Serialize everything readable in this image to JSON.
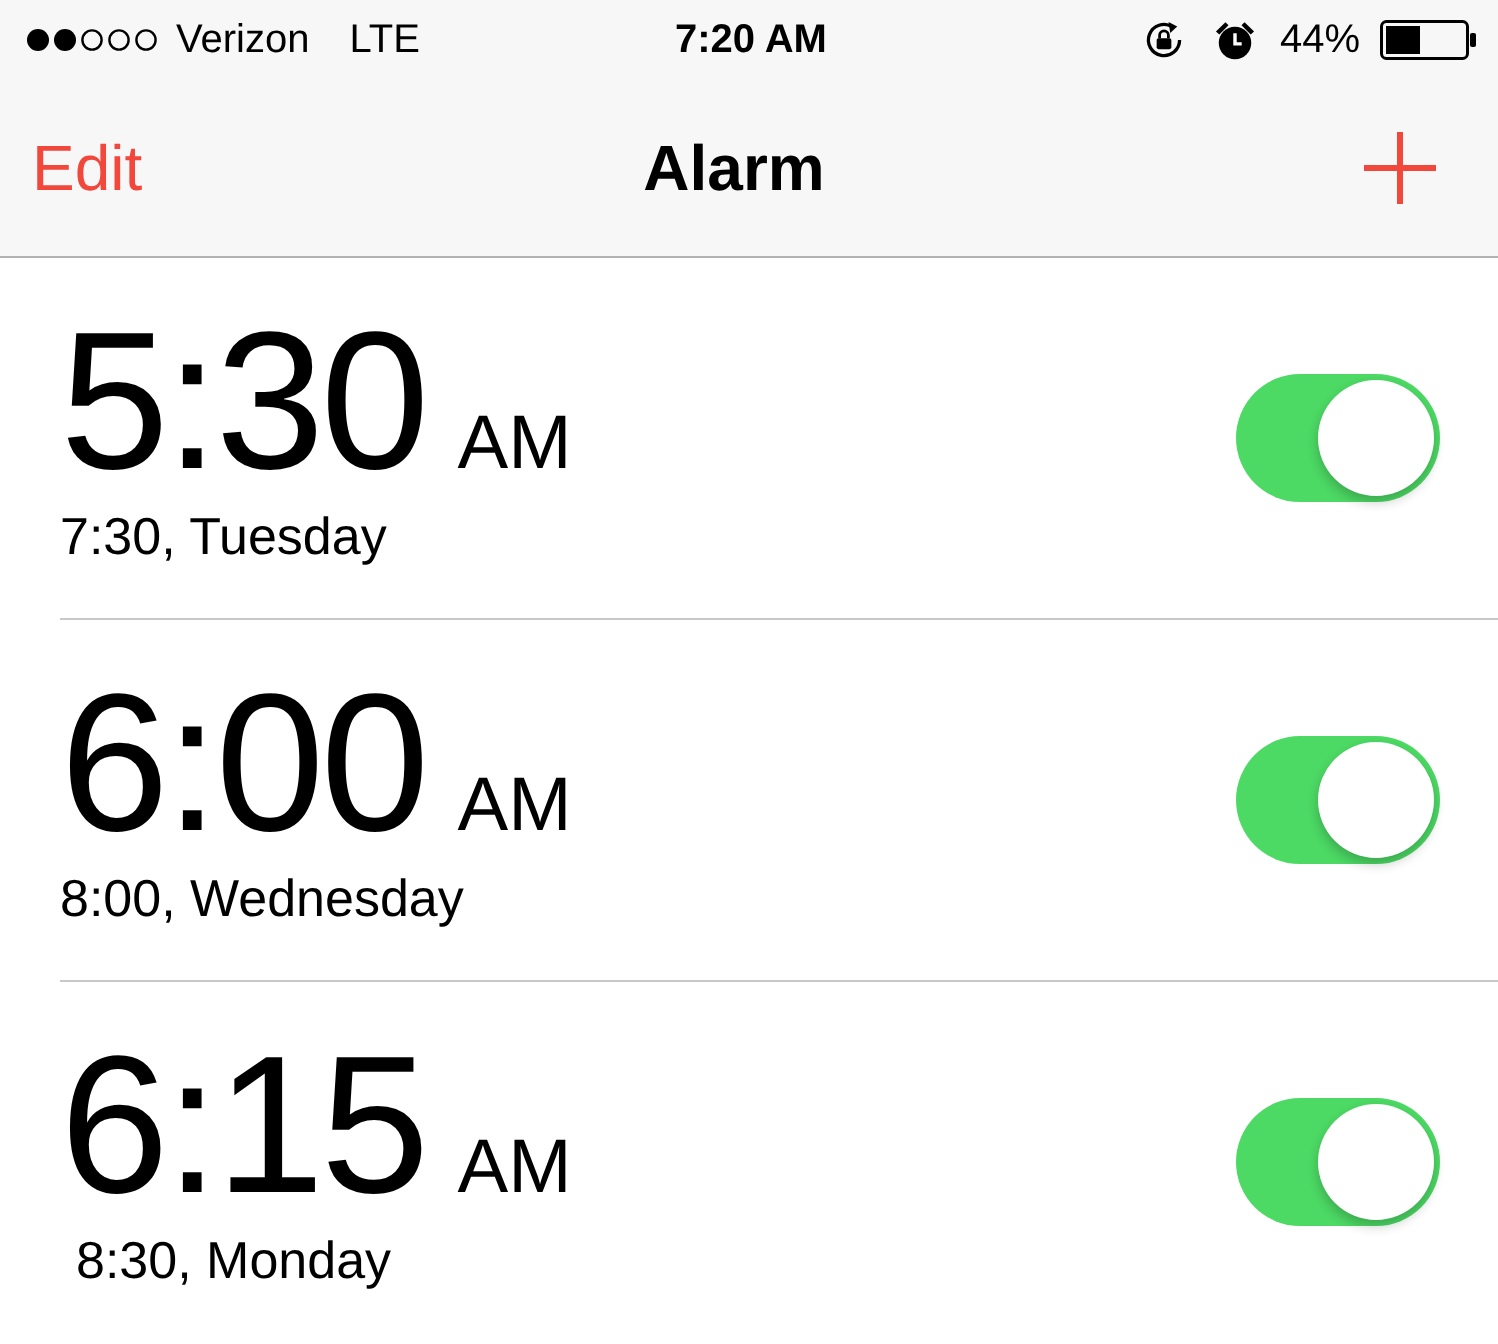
{
  "status_bar": {
    "carrier": "Verizon",
    "network": "LTE",
    "time": "7:20 AM",
    "battery": "44%"
  },
  "nav_bar": {
    "left_button": "Edit",
    "title": "Alarm"
  },
  "alarms": [
    {
      "time": "5:30",
      "period": "AM",
      "label": "7:30, Tuesday",
      "on": true
    },
    {
      "time": "6:00",
      "period": "AM",
      "label": "8:00, Wednesday",
      "on": true
    },
    {
      "time": "6:15",
      "period": "AM",
      "label": "8:30, Monday",
      "on": true
    }
  ]
}
